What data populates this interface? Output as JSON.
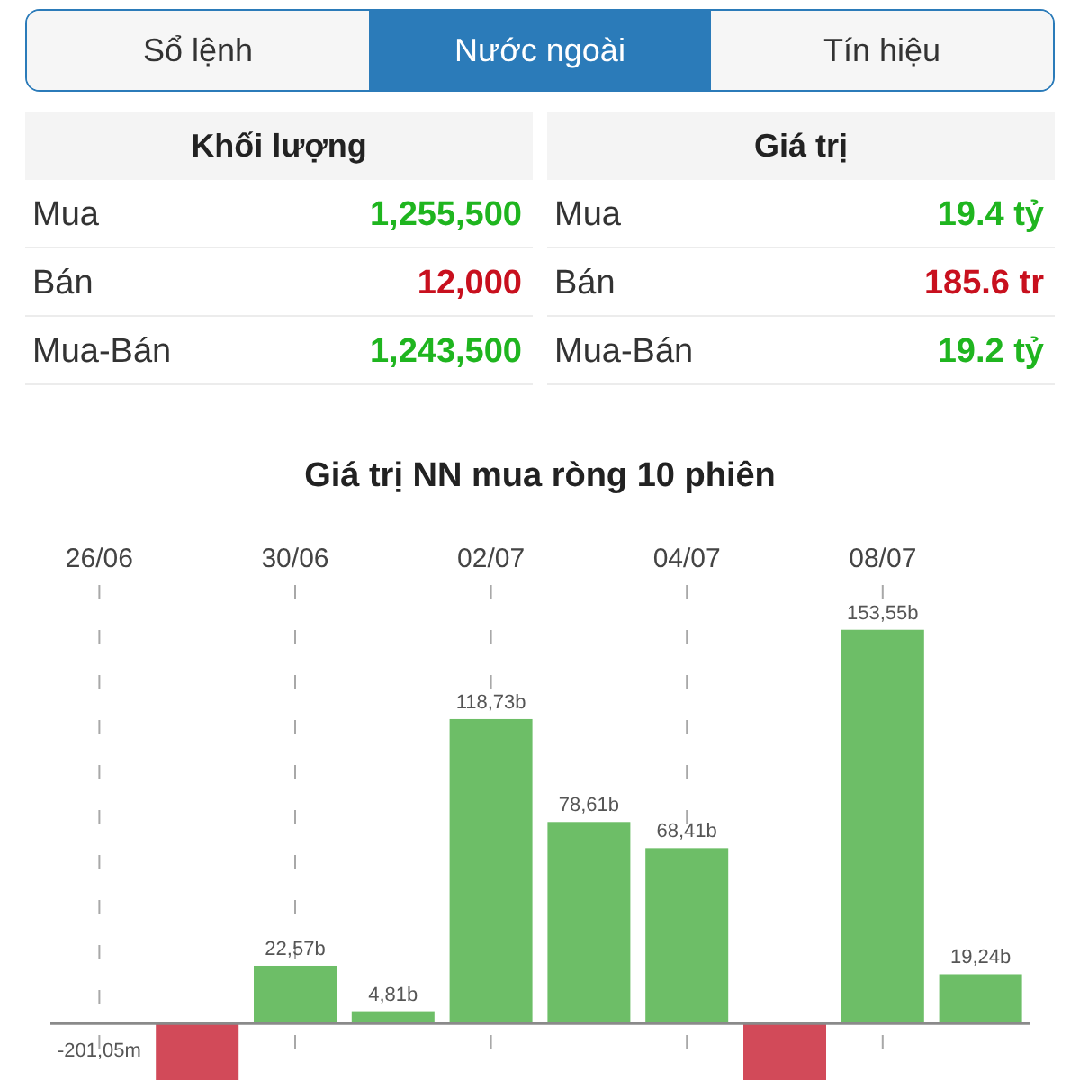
{
  "tabs": [
    {
      "label": "Sổ lệnh",
      "selected": false
    },
    {
      "label": "Nước ngoài",
      "selected": true
    },
    {
      "label": "Tín hiệu",
      "selected": false
    }
  ],
  "summary": {
    "columns": [
      {
        "header": "Khối lượng",
        "rows": [
          {
            "label": "Mua",
            "value": "1,255,500",
            "color": "#1fb51f"
          },
          {
            "label": "Bán",
            "value": "12,000",
            "color": "#c8101e"
          },
          {
            "label": "Mua-Bán",
            "value": "1,243,500",
            "color": "#1fb51f"
          }
        ]
      },
      {
        "header": "Giá trị",
        "rows": [
          {
            "label": "Mua",
            "value": "19.4 tỷ",
            "color": "#1fb51f"
          },
          {
            "label": "Bán",
            "value": "185.6 tr",
            "color": "#c8101e"
          },
          {
            "label": "Mua-Bán",
            "value": "19.2 tỷ",
            "color": "#1fb51f"
          }
        ]
      }
    ]
  },
  "chart": {
    "chart_data": {
      "type": "bar",
      "title": "Giá trị NN mua ròng 10 phiên",
      "categories": [
        "26/06",
        null,
        "30/06",
        null,
        "02/07",
        null,
        "04/07",
        null,
        "08/07",
        null
      ],
      "values": [
        -0.20105,
        -22,
        22.57,
        4.81,
        118.73,
        78.61,
        68.41,
        -22,
        153.55,
        19.24
      ],
      "ylim": [
        -22,
        171
      ],
      "grid": true,
      "value_labels": [
        null,
        null,
        "22,57b",
        "4,81b",
        "118,73b",
        "78,61b",
        "68,41b",
        null,
        "153,55b",
        "19,24b"
      ],
      "annotations": [
        {
          "x": "26/06",
          "y": -0.20105,
          "text": "-201,05m"
        }
      ]
    }
  }
}
